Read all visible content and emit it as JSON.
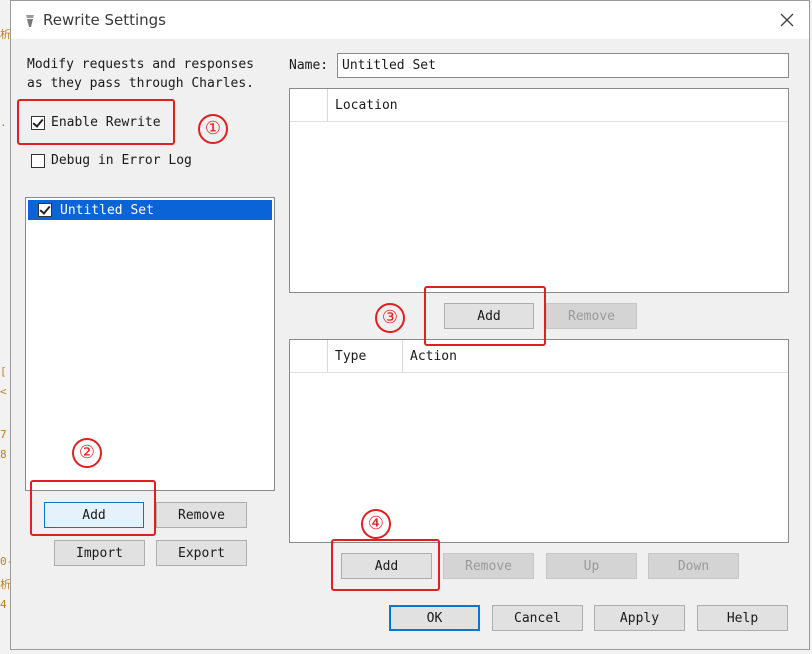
{
  "window": {
    "title": "Rewrite Settings"
  },
  "left": {
    "description_line1": "Modify requests and responses",
    "description_line2": "as they pass through Charles.",
    "enable_rewrite_label": "Enable Rewrite",
    "enable_rewrite_checked": true,
    "debug_label": "Debug in Error Log",
    "debug_checked": false,
    "sets": [
      {
        "label": "Untitled Set",
        "checked": true,
        "selected": true
      }
    ],
    "add_label": "Add",
    "remove_label": "Remove",
    "import_label": "Import",
    "export_label": "Export"
  },
  "right": {
    "name_label": "Name:",
    "name_value": "Untitled Set",
    "locations_table": {
      "columns": [
        "",
        "Location"
      ]
    },
    "location_add_label": "Add",
    "location_remove_label": "Remove",
    "rules_table": {
      "columns": [
        "",
        "Type",
        "Action"
      ]
    },
    "rule_add_label": "Add",
    "rule_remove_label": "Remove",
    "rule_up_label": "Up",
    "rule_down_label": "Down"
  },
  "footer": {
    "ok_label": "OK",
    "cancel_label": "Cancel",
    "apply_label": "Apply",
    "help_label": "Help"
  },
  "annotations": {
    "step1": "①",
    "step2": "②",
    "step3": "③",
    "step4": "④",
    "color": "#e02020"
  }
}
